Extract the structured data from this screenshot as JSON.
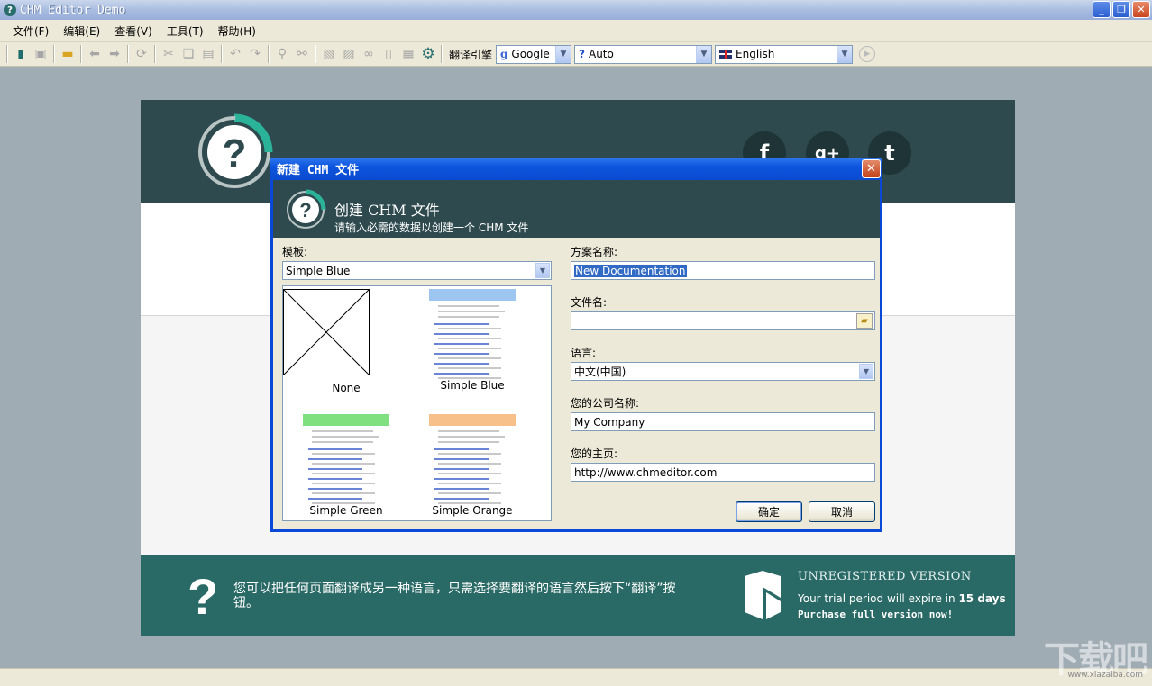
{
  "window": {
    "title": "CHM Editor Demo"
  },
  "menu": [
    "文件(F)",
    "编辑(E)",
    "查看(V)",
    "工具(T)",
    "帮助(H)"
  ],
  "toolbar": {
    "translate_label": "翻译引擎",
    "engine": "Google",
    "source_lang": "Auto",
    "target_lang": "English"
  },
  "page": {
    "footer_text": "您可以把任何页面翻译成另一种语言，只需选择要翻译的语言然后按下“翻译”按钮。",
    "unregistered": "UNREGISTERED VERSION",
    "trial_prefix": "Your trial period will expire in",
    "trial_days": "15 days",
    "purchase": "Purchase full version now!"
  },
  "dialog": {
    "title": "新建 CHM 文件",
    "heading": "创建 CHM 文件",
    "subheading": "请输入必需的数据以创建一个 CHM 文件",
    "template_label": "模板:",
    "template_value": "Simple Blue",
    "templates": [
      "None",
      "Simple Blue",
      "Simple Green",
      "Simple Orange"
    ],
    "project_label": "方案名称:",
    "project_value": "New Documentation",
    "filename_label": "文件名:",
    "filename_value": "",
    "language_label": "语言:",
    "language_value": "中文(中国)",
    "company_label": "您的公司名称:",
    "company_value": "My Company",
    "homepage_label": "您的主页:",
    "homepage_value": "http://www.chmeditor.com",
    "ok_label": "确定",
    "cancel_label": "取消",
    "thumb_colors": {
      "blue": "#9cc6f0",
      "green": "#7ee07e",
      "orange": "#f7c08a"
    }
  },
  "watermark": {
    "text": "下载吧",
    "url": "www.xiazaiba.com"
  }
}
